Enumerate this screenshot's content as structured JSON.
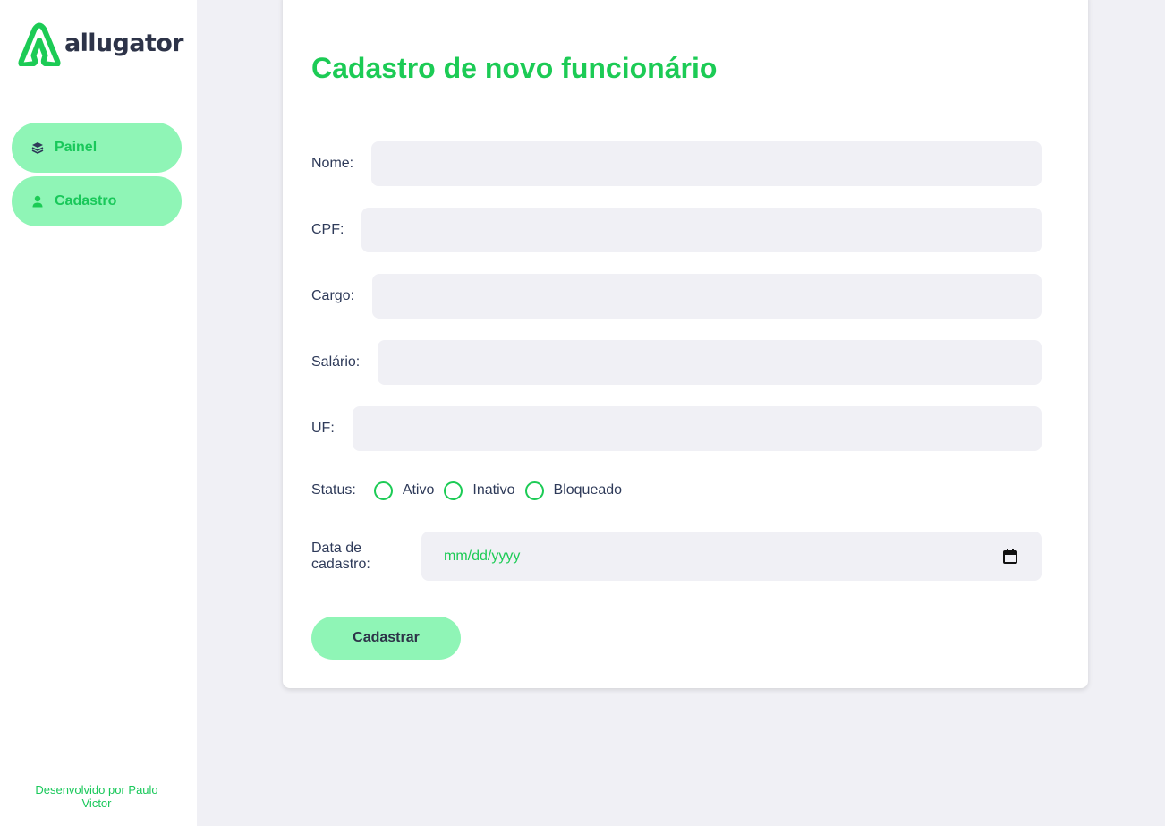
{
  "brand": {
    "name": "allugator",
    "accent": "#1ccb55",
    "nav_bg": "#8ff5b6"
  },
  "sidebar": {
    "items": [
      {
        "label": "Painel",
        "icon": "layers-icon"
      },
      {
        "label": "Cadastro",
        "icon": "user-icon"
      }
    ],
    "footer_line1": "Desenvolvido por Paulo",
    "footer_line2": "Victor"
  },
  "form": {
    "title": "Cadastro de novo funcionário",
    "fields": {
      "nome": {
        "label": "Nome:",
        "value": ""
      },
      "cpf": {
        "label": "CPF:",
        "value": ""
      },
      "cargo": {
        "label": "Cargo:",
        "value": ""
      },
      "salario": {
        "label": "Salário:",
        "value": ""
      },
      "uf": {
        "label": "UF:",
        "value": ""
      }
    },
    "status": {
      "label": "Status:",
      "options": [
        "Ativo",
        "Inativo",
        "Bloqueado"
      ]
    },
    "data_cadastro": {
      "label": "Data de cadastro:",
      "placeholder": "mm/dd/yyyy",
      "icon": "calendar-icon"
    },
    "submit_label": "Cadastrar"
  }
}
